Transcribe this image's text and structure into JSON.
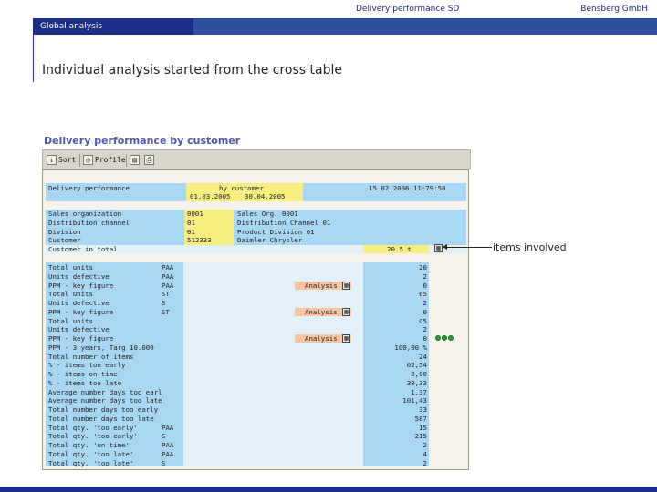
{
  "header": {
    "title": "Delivery performance SD",
    "company": "Bensberg GmbH",
    "section": "Global analysis"
  },
  "headline": "Individual analysis started from the cross table",
  "sap": {
    "title": "Delivery performance by customer",
    "toolbar": {
      "sort": "Sort",
      "profile": "Profile"
    },
    "header_block": {
      "label": "Delivery performance",
      "by": "by customer",
      "period_from": "01.03.2005",
      "period_to": "30.04.2005",
      "date": "15.02.2006 11:79:50"
    },
    "attributes": [
      {
        "label": "Sales organization",
        "code": "0001",
        "text": "Sales Org. 0001"
      },
      {
        "label": "Distribution channel",
        "code": "01",
        "text": "Distribution Channel 01"
      },
      {
        "label": "Division",
        "code": "01",
        "text": "Product Division 01"
      },
      {
        "label": "Customer",
        "code": "512333",
        "text": "Daimler Chrysler"
      },
      {
        "label": "Customer in total",
        "code": "",
        "text": ""
      }
    ],
    "total_value": "20.5 t",
    "rows": [
      {
        "label": "Total units",
        "unit": "PAA",
        "value": "20",
        "analysis": ""
      },
      {
        "label": "Units defective",
        "unit": "PAA",
        "value": "2",
        "analysis": ""
      },
      {
        "label": "PPM - key figure",
        "unit": "PAA",
        "value": "0",
        "analysis": "Analysis"
      },
      {
        "label": "Total units",
        "unit": "ST",
        "value": "65",
        "analysis": ""
      },
      {
        "label": "Units defective",
        "unit": "S",
        "value": "2",
        "analysis": ""
      },
      {
        "label": "PPM - key figure",
        "unit": "ST",
        "value": "0",
        "analysis": "Analysis"
      },
      {
        "label": "Total units",
        "unit": "",
        "value": "C5",
        "analysis": ""
      },
      {
        "label": "Units defective",
        "unit": "",
        "value": "2",
        "analysis": ""
      },
      {
        "label": "PPM - key figure",
        "unit": "",
        "value": "0",
        "analysis": "Analysis"
      },
      {
        "label": "PPM - 3 years, Targ 10.000",
        "unit": "",
        "value": "100,00 %",
        "analysis": ""
      },
      {
        "label": "Total number of items",
        "unit": "",
        "value": "24",
        "analysis": ""
      },
      {
        "label": "% - items too early",
        "unit": "",
        "value": "62,54",
        "analysis": ""
      },
      {
        "label": "% - items on time",
        "unit": "",
        "value": "0,00",
        "analysis": ""
      },
      {
        "label": "% - items too late",
        "unit": "",
        "value": "30,33",
        "analysis": ""
      },
      {
        "label": "Average number days too early",
        "unit": "",
        "value": "1,37",
        "analysis": ""
      },
      {
        "label": "Average number days too late",
        "unit": "",
        "value": "101,43",
        "analysis": ""
      },
      {
        "label": "Total number days too early",
        "unit": "",
        "value": "33",
        "analysis": ""
      },
      {
        "label": "Total number days too late",
        "unit": "",
        "value": "587",
        "analysis": ""
      },
      {
        "label": "Total qty. 'too early'",
        "unit": "PAA",
        "value": "15",
        "analysis": ""
      },
      {
        "label": "Total qty. 'too early'",
        "unit": "S",
        "value": "215",
        "analysis": ""
      },
      {
        "label": "Total qty. 'on time'",
        "unit": "PAA",
        "value": "2",
        "analysis": ""
      },
      {
        "label": "Total qty. 'too late'",
        "unit": "PAA",
        "value": "4",
        "analysis": ""
      },
      {
        "label": "Total qty. 'too late'",
        "unit": "S",
        "value": "2",
        "analysis": ""
      }
    ]
  },
  "annotation": "items involved",
  "colors": {
    "navy": "#1c2f86",
    "band": "#2f4fa1",
    "cell_blue": "#a9d6f3",
    "cell_yellow": "#f6ee80",
    "cell_orange": "#f6c6a4",
    "lamp_green": "#2c9a35"
  }
}
